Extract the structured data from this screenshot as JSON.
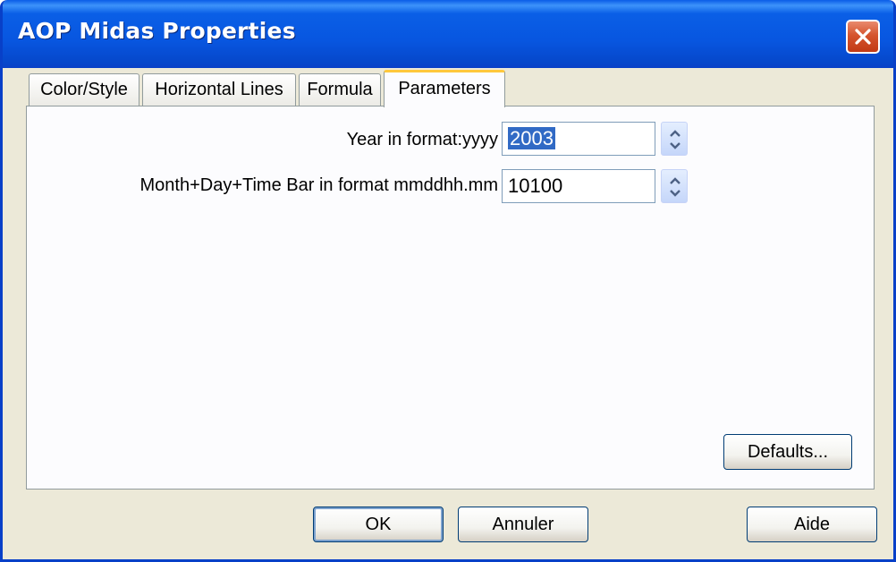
{
  "window": {
    "title": "AOP Midas Properties"
  },
  "tabs": [
    {
      "label": "Color/Style",
      "active": false
    },
    {
      "label": "Horizontal Lines",
      "active": false
    },
    {
      "label": "Formula",
      "active": false
    },
    {
      "label": "Parameters",
      "active": true
    }
  ],
  "params": {
    "year": {
      "label": "Year in format:yyyy",
      "value": "2003",
      "selected": true
    },
    "monthday": {
      "label": "Month+Day+Time Bar in format mmddhh.mm",
      "value": "10100"
    }
  },
  "buttons": {
    "defaults": "Defaults...",
    "ok": "OK",
    "cancel": "Annuler",
    "help": "Aide"
  },
  "icons": {
    "close": "close-icon",
    "spin_up": "chevron-up-icon",
    "spin_down": "chevron-down-icon"
  },
  "colors": {
    "titlebar": "#0A5FE6",
    "close": "#D5542E",
    "tab_accent": "#FFC83C",
    "selection": "#316AC5",
    "face": "#ECE9D8"
  }
}
